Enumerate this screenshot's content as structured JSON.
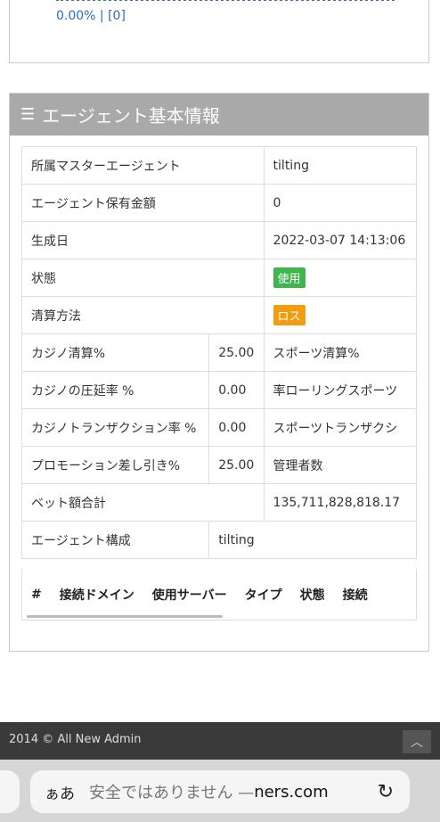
{
  "top_card": {
    "line": "0.00% | [0]"
  },
  "panel": {
    "title": "エージェント基本情報",
    "rows": [
      {
        "label": "所属マスターエージェント",
        "value": "tilting"
      },
      {
        "label": "エージェント保有金額",
        "value": "0"
      },
      {
        "label": "生成日",
        "value": "2022-03-07 14:13:06"
      },
      {
        "label": "状態",
        "value": "使用"
      },
      {
        "label": "清算方法",
        "value": "ロス"
      },
      {
        "label": "カジノ清算%",
        "value": "25.00",
        "label2": "スポーツ清算%"
      },
      {
        "label": "カジノの圧延率 %",
        "value": "0.00",
        "label2": "率ローリングスポーツ"
      },
      {
        "label": "カジノトランザクション率 %",
        "value": "0.00",
        "label2": "スポーツトランザクシ"
      },
      {
        "label": "プロモーション差し引き%",
        "value": "25.00",
        "label2": "管理者数"
      },
      {
        "label": "ベット額合計",
        "value": "135,711,828,818.17"
      },
      {
        "label": "エージェント構成",
        "value": "tilting"
      }
    ],
    "domain_columns": [
      "#",
      "接続ドメイン",
      "使用サーバー",
      "タイプ",
      "状態",
      "接続"
    ]
  },
  "footer": {
    "text": "2014 © All New Admin"
  },
  "browser": {
    "aa": "ぁあ",
    "security": "安全ではありません — ",
    "domain": "ners.com"
  },
  "colors": {
    "header_bg": "#a9a9a9",
    "badge_active": "#3fb54b",
    "badge_loss": "#f39c12",
    "footer_bg": "#3a3a3a"
  }
}
